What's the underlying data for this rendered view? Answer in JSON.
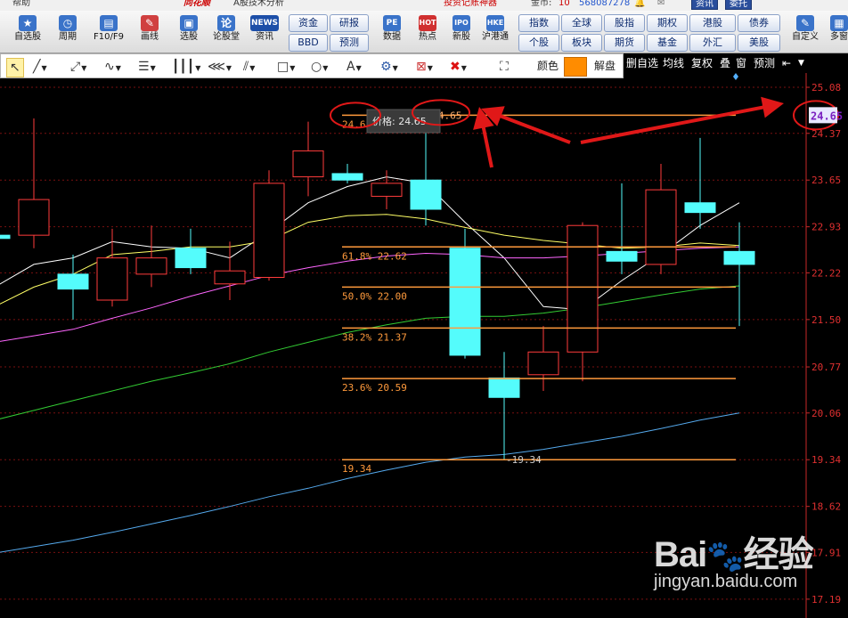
{
  "titlebar": {
    "help_menu": "帮助",
    "brand": "同花顺",
    "window_title": "A股技术分析",
    "promo": "投资记账神器",
    "coins_label": "金币:",
    "coins_value": "10",
    "account_id": "568087278",
    "btn_news": "资讯",
    "btn_trade": "委托"
  },
  "toolbar": {
    "buttons": [
      {
        "label": "自选股",
        "icon": "star-icon"
      },
      {
        "label": "周期",
        "icon": "clock-icon"
      },
      {
        "label": "F10/F9",
        "icon": "f10-icon"
      },
      {
        "label": "画线",
        "icon": "pencil-icon"
      },
      {
        "label": "选股",
        "icon": "stock-picker-icon"
      },
      {
        "label": "论股堂",
        "icon": "forum-icon"
      },
      {
        "label": "资讯",
        "icon": "news-icon"
      }
    ],
    "news_glyph": "NEWS",
    "forum_glyph": "论",
    "pills_row1": [
      "资金",
      "研报"
    ],
    "pills_row2": [
      "BBD",
      "预测"
    ],
    "buttons2": [
      {
        "label": "数据",
        "icon": "pe-icon",
        "glyph": "PE"
      },
      {
        "label": "热点",
        "icon": "hot-icon",
        "glyph": "HOT"
      },
      {
        "label": "新股",
        "icon": "ipo-icon",
        "glyph": "IPO"
      },
      {
        "label": "沪港通",
        "icon": "sse-hke-icon",
        "glyph": "HKE"
      }
    ],
    "market_pills_row1": [
      "指数",
      "全球",
      "股指",
      "期权",
      "港股",
      "债券"
    ],
    "market_pills_row2": [
      "个股",
      "板块",
      "期货",
      "基金",
      "外汇",
      "美股"
    ],
    "custom_label": "自定义",
    "more_label": "多窗"
  },
  "drawbar": {
    "color_label": "颜色",
    "color_value": "#ff8c00",
    "unlock_label": "解盘"
  },
  "righttabs": {
    "items": [
      "删自选",
      "均线",
      "复权",
      "叠",
      "窗",
      "预测"
    ]
  },
  "chart_data": {
    "type": "candlestick",
    "y_ticks": [
      "25.08",
      "24.37",
      "23.65",
      "22.93",
      "22.22",
      "21.50",
      "20.77",
      "20.06",
      "19.34",
      "18.62",
      "17.91",
      "17.19"
    ],
    "ylim": [
      16.9,
      25.3
    ],
    "current_price": "24.65",
    "fib_levels": [
      {
        "label": "24.65",
        "value": 24.65
      },
      {
        "label": "61.8%  22.62",
        "value": 22.62
      },
      {
        "label": "50.0%  22.00",
        "value": 22.0
      },
      {
        "label": "38.2%  21.37",
        "value": 21.37
      },
      {
        "label": "23.6%  20.59",
        "value": 20.59
      },
      {
        "label": "19.34",
        "value": 19.34
      }
    ],
    "top_marker": "24.65",
    "low_marker": "19.34",
    "tooltip": "价格: 24.65",
    "candles": [
      {
        "o": 22.8,
        "c": 22.75,
        "h": 22.9,
        "l": 22.7
      },
      {
        "o": 22.8,
        "c": 23.35,
        "h": 24.6,
        "l": 22.6
      },
      {
        "o": 22.2,
        "c": 21.97,
        "h": 22.5,
        "l": 21.5
      },
      {
        "o": 21.8,
        "c": 22.45,
        "h": 22.9,
        "l": 21.7
      },
      {
        "o": 22.2,
        "c": 22.45,
        "h": 22.95,
        "l": 22.0
      },
      {
        "o": 22.6,
        "c": 22.3,
        "h": 22.9,
        "l": 22.2
      },
      {
        "o": 22.05,
        "c": 22.25,
        "h": 22.7,
        "l": 21.8
      },
      {
        "o": 22.15,
        "c": 23.6,
        "h": 23.8,
        "l": 22.1
      },
      {
        "o": 23.7,
        "c": 24.1,
        "h": 24.55,
        "l": 23.4
      },
      {
        "o": 23.75,
        "c": 23.65,
        "h": 23.9,
        "l": 23.6
      },
      {
        "o": 23.4,
        "c": 23.6,
        "h": 23.8,
        "l": 23.2
      },
      {
        "o": 23.65,
        "c": 23.2,
        "h": 24.65,
        "l": 22.95
      },
      {
        "o": 22.6,
        "c": 20.95,
        "h": 22.9,
        "l": 20.9
      },
      {
        "o": 20.6,
        "c": 20.3,
        "h": 21.0,
        "l": 19.35
      },
      {
        "o": 20.65,
        "c": 21.0,
        "h": 21.4,
        "l": 20.4
      },
      {
        "o": 21.0,
        "c": 22.95,
        "h": 23.0,
        "l": 20.55
      },
      {
        "o": 22.55,
        "c": 22.4,
        "h": 23.6,
        "l": 22.2
      },
      {
        "o": 22.35,
        "c": 23.5,
        "h": 23.9,
        "l": 22.2
      },
      {
        "o": 23.3,
        "c": 23.15,
        "h": 24.3,
        "l": 22.9
      },
      {
        "o": 22.55,
        "c": 22.35,
        "h": 23.0,
        "l": 21.4
      }
    ],
    "ma_series": [
      {
        "color": "#ffffff",
        "values": [
          22.0,
          22.35,
          22.45,
          22.7,
          22.62,
          22.6,
          22.45,
          22.85,
          23.3,
          23.55,
          23.7,
          23.6,
          23.0,
          22.45,
          21.7,
          21.65,
          22.1,
          22.5,
          22.95,
          23.3
        ]
      },
      {
        "color": "#ffff66",
        "values": [
          21.7,
          22.0,
          22.2,
          22.5,
          22.55,
          22.62,
          22.62,
          22.72,
          23.0,
          23.1,
          23.12,
          23.05,
          22.92,
          22.8,
          22.72,
          22.66,
          22.6,
          22.62,
          22.68,
          22.64
        ]
      },
      {
        "color": "#ff66ff",
        "values": [
          21.15,
          21.25,
          21.35,
          21.52,
          21.68,
          21.86,
          22.02,
          22.18,
          22.3,
          22.4,
          22.48,
          22.52,
          22.5,
          22.45,
          22.45,
          22.48,
          22.52,
          22.56,
          22.6,
          22.62
        ]
      },
      {
        "color": "#33cc33",
        "values": [
          19.95,
          20.1,
          20.25,
          20.4,
          20.55,
          20.68,
          20.82,
          21.0,
          21.15,
          21.3,
          21.42,
          21.52,
          21.55,
          21.55,
          21.6,
          21.68,
          21.78,
          21.88,
          21.97,
          22.02
        ]
      },
      {
        "color": "#55aaee",
        "values": [
          17.9,
          18.0,
          18.1,
          18.22,
          18.35,
          18.48,
          18.62,
          18.77,
          18.9,
          19.05,
          19.18,
          19.3,
          19.38,
          19.42,
          19.5,
          19.6,
          19.7,
          19.82,
          19.95,
          20.06
        ]
      }
    ]
  }
}
